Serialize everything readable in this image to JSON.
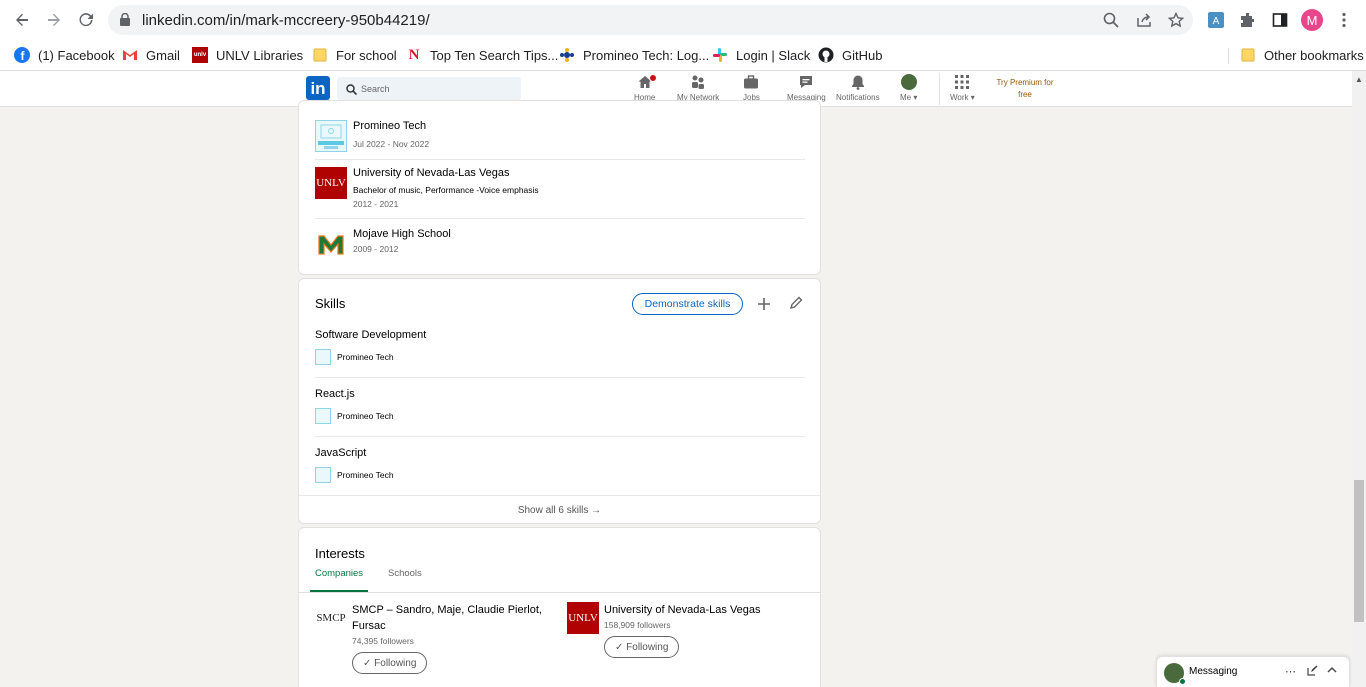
{
  "browser": {
    "url": "linkedin.com/in/mark-mccreery-950b44219/",
    "profile_initial": "M"
  },
  "bookmarks": [
    {
      "label": "(1) Facebook",
      "icon": "facebook-icon"
    },
    {
      "label": "Gmail",
      "icon": "gmail-icon"
    },
    {
      "label": "UNLV Libraries",
      "icon": "unlv-icon"
    },
    {
      "label": "For school",
      "icon": "folder-icon"
    },
    {
      "label": "Top Ten Search Tips...",
      "icon": "n-icon"
    },
    {
      "label": "Promineo Tech: Log...",
      "icon": "promineo-icon"
    },
    {
      "label": "Login | Slack",
      "icon": "slack-icon"
    },
    {
      "label": "GitHub",
      "icon": "github-icon"
    }
  ],
  "other_bookmarks": "Other bookmarks",
  "linkedin_nav": {
    "logo": "in",
    "search_placeholder": "Search",
    "items": {
      "home": "Home",
      "network": "My Network",
      "jobs": "Jobs",
      "messaging": "Messaging",
      "notifications": "Notifications",
      "me": "Me",
      "work": "Work"
    },
    "premium": "Try Premium for free"
  },
  "education": [
    {
      "title": "Promineo Tech",
      "dates": "Jul 2022 - Nov 2022"
    },
    {
      "title": "University of Nevada-Las Vegas",
      "degree": "Bachelor of music, Performance -Voice emphasis",
      "dates": "2012 - 2021",
      "logo_text": "UNLV"
    },
    {
      "title": "Mojave High School",
      "dates": "2009 - 2012"
    }
  ],
  "skills": {
    "title": "Skills",
    "demonstrate_label": "Demonstrate skills",
    "items": [
      {
        "name": "Software Development",
        "source": "Promineo Tech"
      },
      {
        "name": "React.js",
        "source": "Promineo Tech"
      },
      {
        "name": "JavaScript",
        "source": "Promineo Tech"
      }
    ],
    "show_all": "Show all 6 skills →"
  },
  "interests": {
    "title": "Interests",
    "tabs": [
      "Companies",
      "Schools"
    ],
    "companies": [
      {
        "name": "SMCP – Sandro, Maje, Claudie Pierlot, Fursac",
        "followers": "74,395 followers",
        "button": "✓ Following",
        "logo_text": "SMCP"
      },
      {
        "name": "University of Nevada-Las Vegas",
        "followers": "158,909 followers",
        "button": "✓ Following",
        "logo_text": "UNLV"
      }
    ]
  },
  "messaging_bar": {
    "label": "Messaging"
  },
  "colors": {
    "linkedin_blue": "#0a66c2",
    "active_green": "#057642",
    "unlv_red": "#b10202",
    "premium_gold": "#915907"
  }
}
